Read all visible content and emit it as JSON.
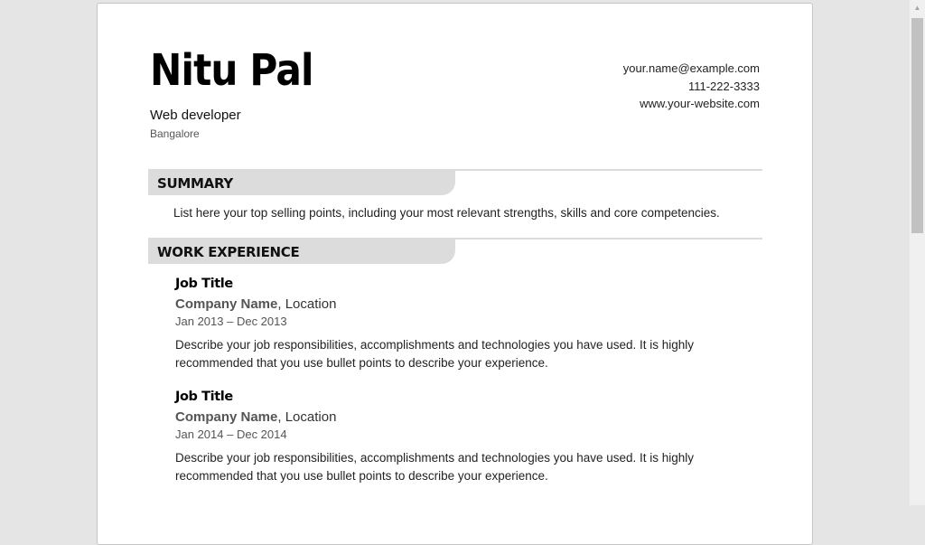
{
  "header": {
    "name": "Nitu Pal",
    "role": "Web developer",
    "city": "Bangalore",
    "email": "your.name@example.com",
    "phone": "111-222-3333",
    "website": "www.your-website.com"
  },
  "summary": {
    "title": "SUMMARY",
    "text": "List here your top selling points, including your most relevant strengths, skills and core competencies."
  },
  "work": {
    "title": "WORK EXPERIENCE",
    "jobs": [
      {
        "title": "Job Title",
        "company": "Company Name",
        "location": ", Location",
        "dates": "Jan 2013 – Dec 2013",
        "description": "Describe your job responsibilities, accomplishments and technologies you have used. It is highly recommended that you use bullet points to describe your experience."
      },
      {
        "title": "Job Title",
        "company": "Company Name",
        "location": ", Location",
        "dates": "Jan 2014 – Dec 2014",
        "description": "Describe your job responsibilities, accomplishments and technologies you have used. It is highly recommended that you use bullet points to describe your experience."
      }
    ]
  },
  "colors": {
    "page_bg": "#e5e5e5",
    "section_tab": "#dcdcdc",
    "text": "#222222"
  },
  "icons": {
    "scroll_up": "triangle-up-icon"
  }
}
